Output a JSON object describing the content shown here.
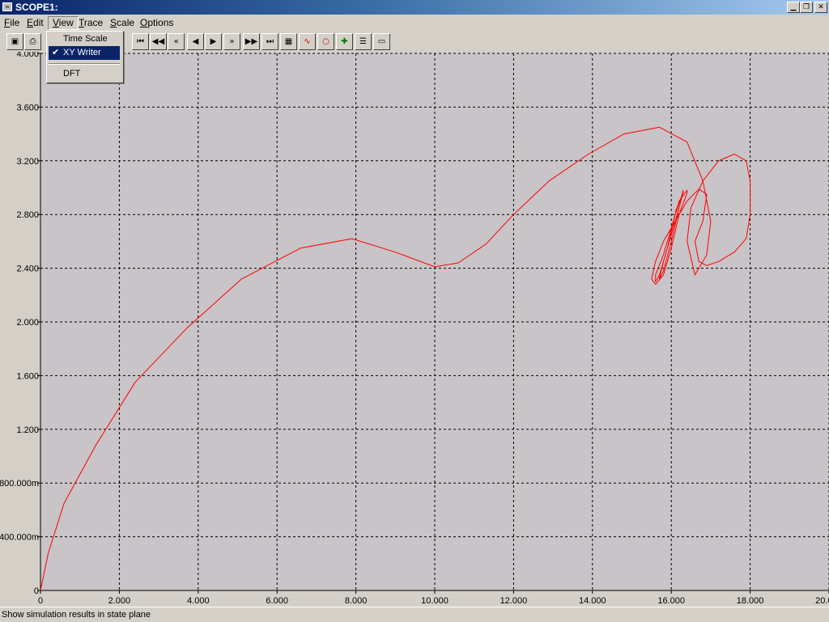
{
  "window": {
    "title": "SCOPE1:",
    "icon": "scope-icon",
    "minimize": "minimize-icon",
    "restore": "restore-icon",
    "close": "close-icon"
  },
  "menu": {
    "items": [
      {
        "pre": "",
        "ul": "F",
        "post": "ile"
      },
      {
        "pre": "",
        "ul": "E",
        "post": "dit"
      },
      {
        "pre": "",
        "ul": "V",
        "post": "iew"
      },
      {
        "pre": "",
        "ul": "T",
        "post": "race"
      },
      {
        "pre": "",
        "ul": "S",
        "post": "cale"
      },
      {
        "pre": "",
        "ul": "O",
        "post": "ptions"
      }
    ]
  },
  "view_menu": {
    "items": [
      {
        "label": "Time Scale",
        "checked": false,
        "selected": false
      },
      {
        "label": "XY Writer",
        "checked": true,
        "selected": true
      },
      {
        "label": "DFT",
        "checked": false,
        "selected": false
      }
    ]
  },
  "toolbar": {
    "icons": [
      "save-icon",
      "print-icon",
      "first-icon",
      "fast-rewind-icon",
      "rewind-icon",
      "step-back-icon",
      "step-forward-icon",
      "forward-icon",
      "fast-forward-icon",
      "last-icon",
      "table-icon",
      "trace-icon",
      "marker-icon",
      "cursor-icon",
      "list-icon",
      "window-icon"
    ]
  },
  "chart_data": {
    "type": "line",
    "xlim": [
      0,
      20
    ],
    "ylim": [
      0,
      4
    ],
    "x_ticks": [
      0,
      2,
      4,
      6,
      8,
      10,
      12,
      14,
      16,
      18,
      20
    ],
    "x_tick_labels": [
      "0",
      "2.000",
      "4.000",
      "6.000",
      "8.000",
      "10.000",
      "12.000",
      "14.000",
      "16.000",
      "18.000",
      "20.000"
    ],
    "y_ticks": [
      0,
      0.4,
      0.8,
      1.2,
      1.6,
      2.0,
      2.4,
      2.8,
      3.2,
      3.6,
      4.0
    ],
    "y_tick_labels": [
      "0",
      "400.000m",
      "800.000m",
      "1.200",
      "1.600",
      "2.000",
      "2.400",
      "2.800",
      "3.200",
      "3.600",
      "4.000"
    ],
    "grid": true,
    "line_color": "#ff0000",
    "background": "#c8c4c8",
    "series": [
      {
        "x": [
          0,
          0.2,
          0.6,
          1.4,
          2.4,
          3.7,
          5.1,
          6.6,
          7.9,
          9.0,
          10.0,
          10.6,
          11.3,
          12.0,
          12.9,
          13.9,
          14.8,
          15.7,
          16.4,
          16.8,
          17.0,
          16.9,
          16.6,
          16.4,
          16.5,
          16.8,
          17.2,
          17.6,
          17.9,
          18.0,
          18.0,
          17.9,
          17.6,
          17.2,
          16.9,
          16.7,
          16.6,
          16.8,
          16.9,
          16.7,
          16.4,
          16.1,
          15.8,
          15.6,
          15.5,
          15.6,
          15.8,
          16.0,
          16.2,
          16.4,
          16.4,
          16.2,
          16.0,
          15.8,
          15.6,
          15.6,
          15.7,
          15.9,
          16.1,
          16.3,
          16.3,
          16.2,
          16.0,
          15.8,
          15.7,
          15.7,
          15.8,
          16.0,
          16.2,
          16.3,
          16.3,
          16.1
        ],
        "y": [
          0,
          0.28,
          0.65,
          1.08,
          1.55,
          1.95,
          2.32,
          2.55,
          2.62,
          2.52,
          2.41,
          2.44,
          2.58,
          2.8,
          3.05,
          3.25,
          3.4,
          3.45,
          3.34,
          3.05,
          2.75,
          2.5,
          2.35,
          2.6,
          2.85,
          3.05,
          3.2,
          3.25,
          3.2,
          3.05,
          2.8,
          2.62,
          2.52,
          2.45,
          2.42,
          2.45,
          2.6,
          2.75,
          2.95,
          2.99,
          2.9,
          2.75,
          2.6,
          2.45,
          2.32,
          2.28,
          2.35,
          2.55,
          2.8,
          2.96,
          2.98,
          2.9,
          2.7,
          2.5,
          2.35,
          2.3,
          2.35,
          2.55,
          2.8,
          2.97,
          2.97,
          2.85,
          2.65,
          2.45,
          2.33,
          2.32,
          2.38,
          2.6,
          2.85,
          2.98,
          2.96,
          2.82
        ]
      }
    ]
  },
  "status": {
    "text": "Show simulation results in state plane"
  }
}
